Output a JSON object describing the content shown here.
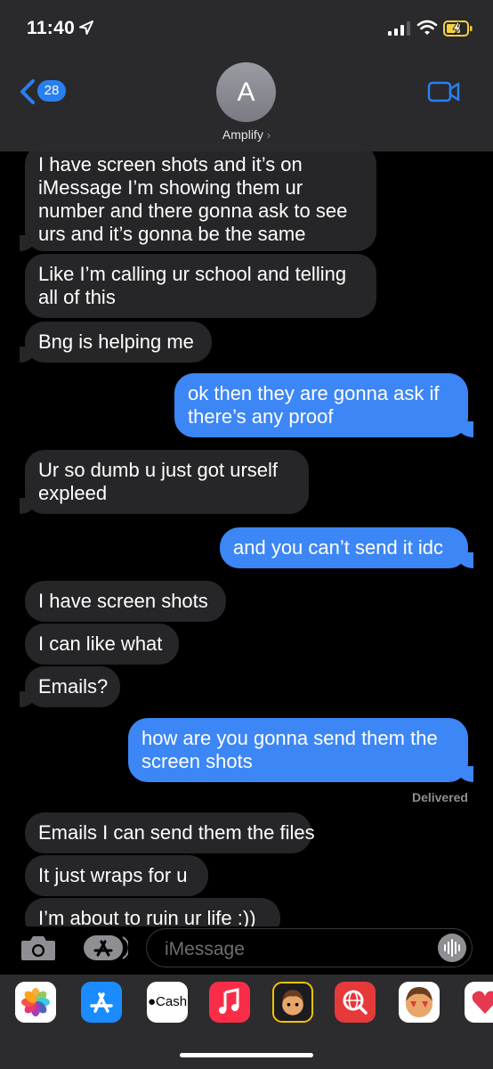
{
  "status": {
    "time": "11:40"
  },
  "header": {
    "back_badge": "28",
    "avatar_initial": "A",
    "contact_name": "Amplify"
  },
  "messages": [
    {
      "dir": "in",
      "lines": [
        "I have screen shots and it’s on",
        "iMessage I’m showing them ur",
        "number and there gonna ask to see",
        "urs and it’s gonna be the same"
      ]
    },
    {
      "dir": "in",
      "lines": [
        "Like I’m calling ur school and telling",
        "all of this"
      ]
    },
    {
      "dir": "in",
      "lines": [
        "Bng is helping me"
      ]
    },
    {
      "dir": "out",
      "lines": [
        "ok then they are gonna ask if",
        "there’s any proof"
      ]
    },
    {
      "dir": "in",
      "lines": [
        "Ur so dumb u just got urself",
        "expleed"
      ]
    },
    {
      "dir": "out",
      "lines": [
        "and you can’t send it idc"
      ]
    },
    {
      "dir": "in",
      "lines": [
        "I have screen shots"
      ]
    },
    {
      "dir": "in",
      "lines": [
        "I can like what"
      ]
    },
    {
      "dir": "in",
      "lines": [
        "Emails?"
      ]
    },
    {
      "dir": "out",
      "lines": [
        "how are you gonna send them the",
        "screen shots"
      ]
    },
    {
      "dir": "in",
      "lines": [
        "Emails I can send them the files"
      ]
    },
    {
      "dir": "in",
      "lines": [
        "It just wraps for u"
      ]
    },
    {
      "dir": "in",
      "lines": [
        "I’m about to ruin ur life :))"
      ]
    }
  ],
  "delivered_label": "Delivered",
  "compose": {
    "placeholder": "iMessage"
  },
  "apps": [
    {
      "name": "photos-app-icon"
    },
    {
      "name": "app-store-app-icon"
    },
    {
      "name": "apple-cash-app-icon",
      "label": "Cash"
    },
    {
      "name": "music-app-icon"
    },
    {
      "name": "memoji-app-icon"
    },
    {
      "name": "web-search-app-icon"
    },
    {
      "name": "memoji-stickers-app-icon"
    },
    {
      "name": "heart-app-icon"
    }
  ],
  "colors": {
    "incoming": "#262628",
    "outgoing": "#3d86f5",
    "accent": "#2a7ff0"
  }
}
